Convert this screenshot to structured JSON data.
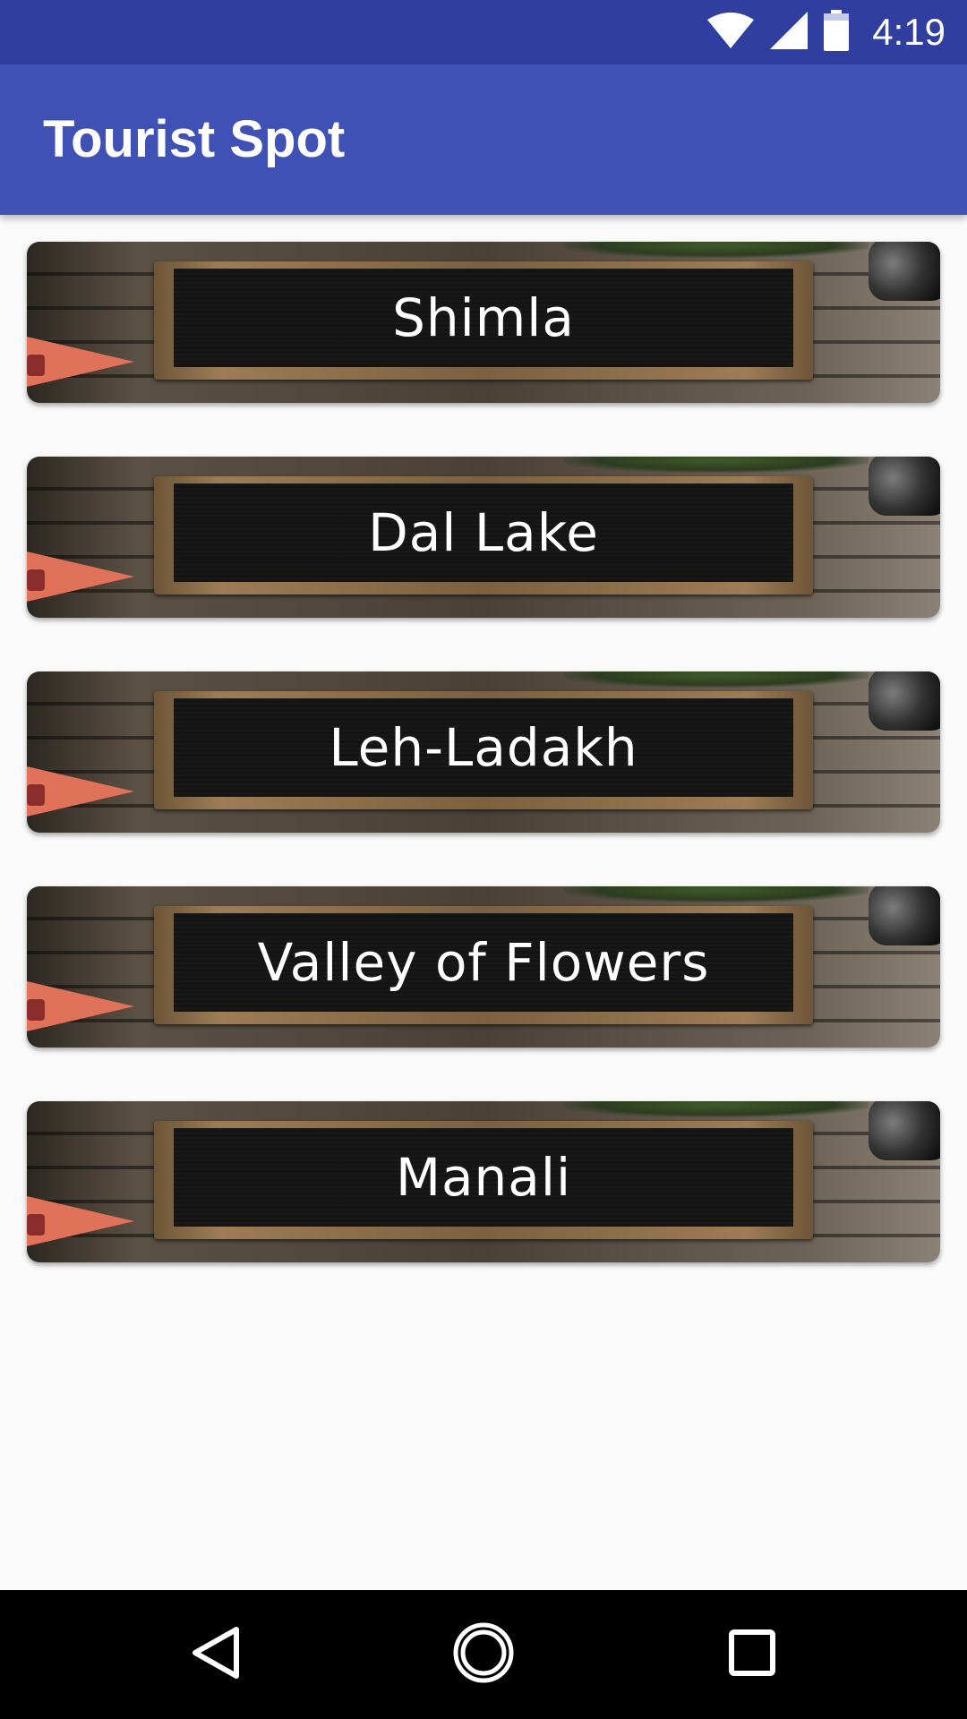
{
  "status_bar": {
    "time": "4:19",
    "icons": [
      "wifi-icon",
      "signal-icon",
      "battery-icon"
    ]
  },
  "app_bar": {
    "title": "Tourist Spot"
  },
  "spots": [
    {
      "name": "Shimla"
    },
    {
      "name": "Dal Lake"
    },
    {
      "name": "Leh-Ladakh"
    },
    {
      "name": "Valley of Flowers"
    },
    {
      "name": "Manali"
    }
  ],
  "navigation": {
    "buttons": [
      "back-icon",
      "home-icon",
      "recents-icon"
    ]
  },
  "colors": {
    "status_bar": "#303f9f",
    "app_bar": "#3f51b5",
    "background": "#fafafa"
  }
}
